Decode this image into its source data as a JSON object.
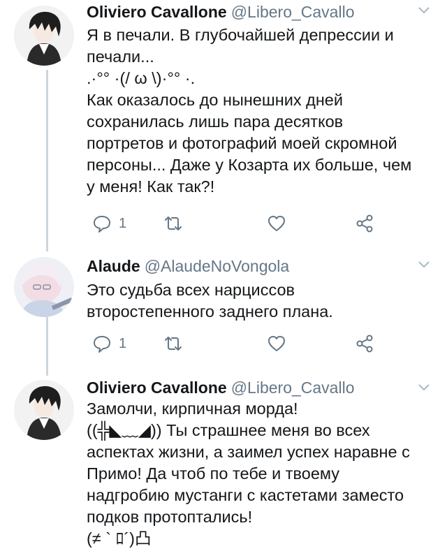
{
  "tweets": [
    {
      "name": "Oliviero Cavallone",
      "handle": "@Libero_Cavallo",
      "lines": [
        "Я в печали. В глубочайшей депрессии и",
        "печали...",
        ".·°° ·(/ ω \\)·°° ·.",
        "Как оказалось до нынешних дней",
        "сохранилась лишь пара десятков",
        "портретов и фотографий моей скромной",
        "персоны... Даже у Козарта их больше, чем",
        "у меня! Как так?!"
      ],
      "reply_count": "1"
    },
    {
      "name": "Alaude",
      "handle": "@AlaudeNoVongola",
      "lines": [
        "Это судьба всех нарциссов",
        "второстепенного заднего плана."
      ],
      "reply_count": "1"
    },
    {
      "name": "Oliviero Cavallone",
      "handle": "@Libero_Cavallo",
      "lines": [
        "Замолчи, кирпичная морда!",
        "((╬◣﹏◢)) Ты страшнее меня во всех",
        "аспектах жизни, а заимел успех наравне с",
        "Примо! Да чтоб по тебе и твоему",
        "надгробию мустанги с кастетами заместо",
        "подков протоптались!",
        "(≠ ` ﾛ´)凸"
      ]
    }
  ],
  "icons": {
    "reply": "reply-icon",
    "retweet": "retweet-icon",
    "like": "like-icon",
    "share": "share-icon",
    "caret": "chevron-down-icon"
  },
  "colors": {
    "text": "#14171a",
    "secondary": "#657786",
    "thread_line": "#ccd6dd",
    "divider": "#e6ecf0"
  }
}
